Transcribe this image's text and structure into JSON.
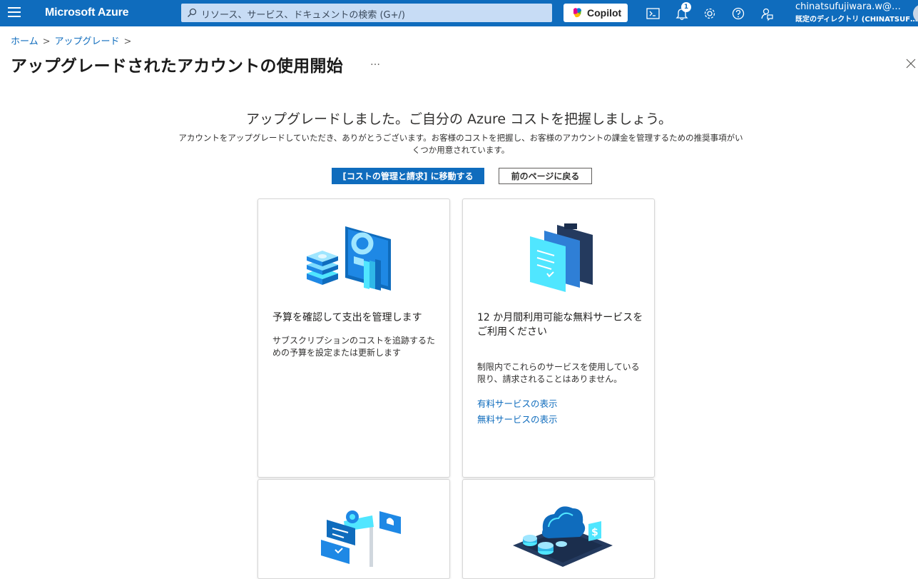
{
  "topbar": {
    "brand": "Microsoft Azure",
    "search_placeholder": "リソース、サービス、ドキュメントの検索 (G+/)",
    "copilot_label": "Copilot",
    "notification_count": "1",
    "account_email": "chinatsufujiwara.w@…",
    "account_directory": "既定のディレクトリ (CHINATSUF…"
  },
  "breadcrumb": {
    "home": "ホーム",
    "current": "アップグレード",
    "separator": ">"
  },
  "page": {
    "title": "アップグレードされたアカウントの使用開始",
    "more": "…"
  },
  "hero": {
    "title": "アップグレードしました。ご自分の Azure コストを把握しましょう。",
    "description": "アカウントをアップグレードしていただき、ありがとうございます。お客様のコストを把握し、お客様のアカウントの課金を管理するための推奨事項がいくつか用意されています。",
    "primary_button": "[コストの管理と請求] に移動する",
    "secondary_button": "前のページに戻る"
  },
  "cards": [
    {
      "title": "予算を確認して支出を管理します",
      "body": "サブスクリプションのコストを追跡するための予算を設定または更新します"
    },
    {
      "title": "12 か月間利用可能な無料サービスをご利用ください",
      "body": "制限内でこれらのサービスを使用している限り、請求されることはありません。",
      "link_paid": "有料サービスの表示",
      "link_free": "無料サービスの表示"
    }
  ],
  "colors": {
    "azure_blue": "#0f6cbd",
    "search_bg": "#c7dcf5",
    "illustration_light": "#50e6ff",
    "illustration_dark": "#243a5e"
  }
}
